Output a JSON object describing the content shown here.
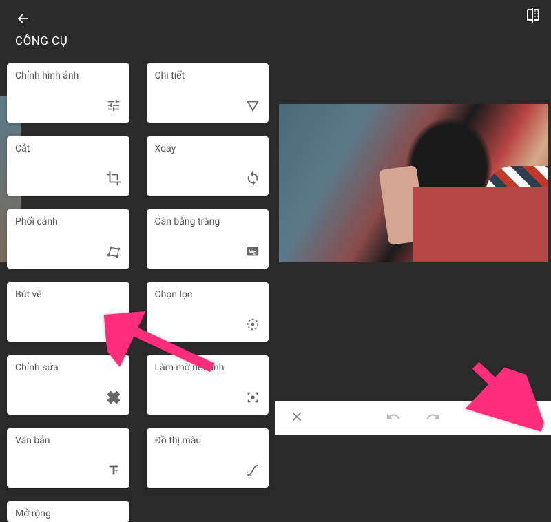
{
  "leftPanel": {
    "title": "CÔNG CỤ",
    "tools": [
      {
        "id": "tune",
        "label": "Chỉnh hình ảnh"
      },
      {
        "id": "details",
        "label": "Chi tiết"
      },
      {
        "id": "crop",
        "label": "Cắt"
      },
      {
        "id": "rotate",
        "label": "Xoay"
      },
      {
        "id": "perspective",
        "label": "Phối cảnh"
      },
      {
        "id": "whitebalance",
        "label": "Cân bằng trắng"
      },
      {
        "id": "brush",
        "label": "Bút vẽ"
      },
      {
        "id": "selective",
        "label": "Chọn lọc"
      },
      {
        "id": "healing",
        "label": "Chỉnh sửa"
      },
      {
        "id": "blur",
        "label": "Làm mờ nét ảnh"
      },
      {
        "id": "text",
        "label": "Văn bản"
      },
      {
        "id": "curves",
        "label": "Đồ thị màu"
      },
      {
        "id": "expand",
        "label": "Mở rộng"
      }
    ]
  },
  "rightPanel": {
    "bottomActions": {
      "cancel": "cancel",
      "undo": "undo",
      "redo": "redo",
      "apply": "apply"
    }
  }
}
